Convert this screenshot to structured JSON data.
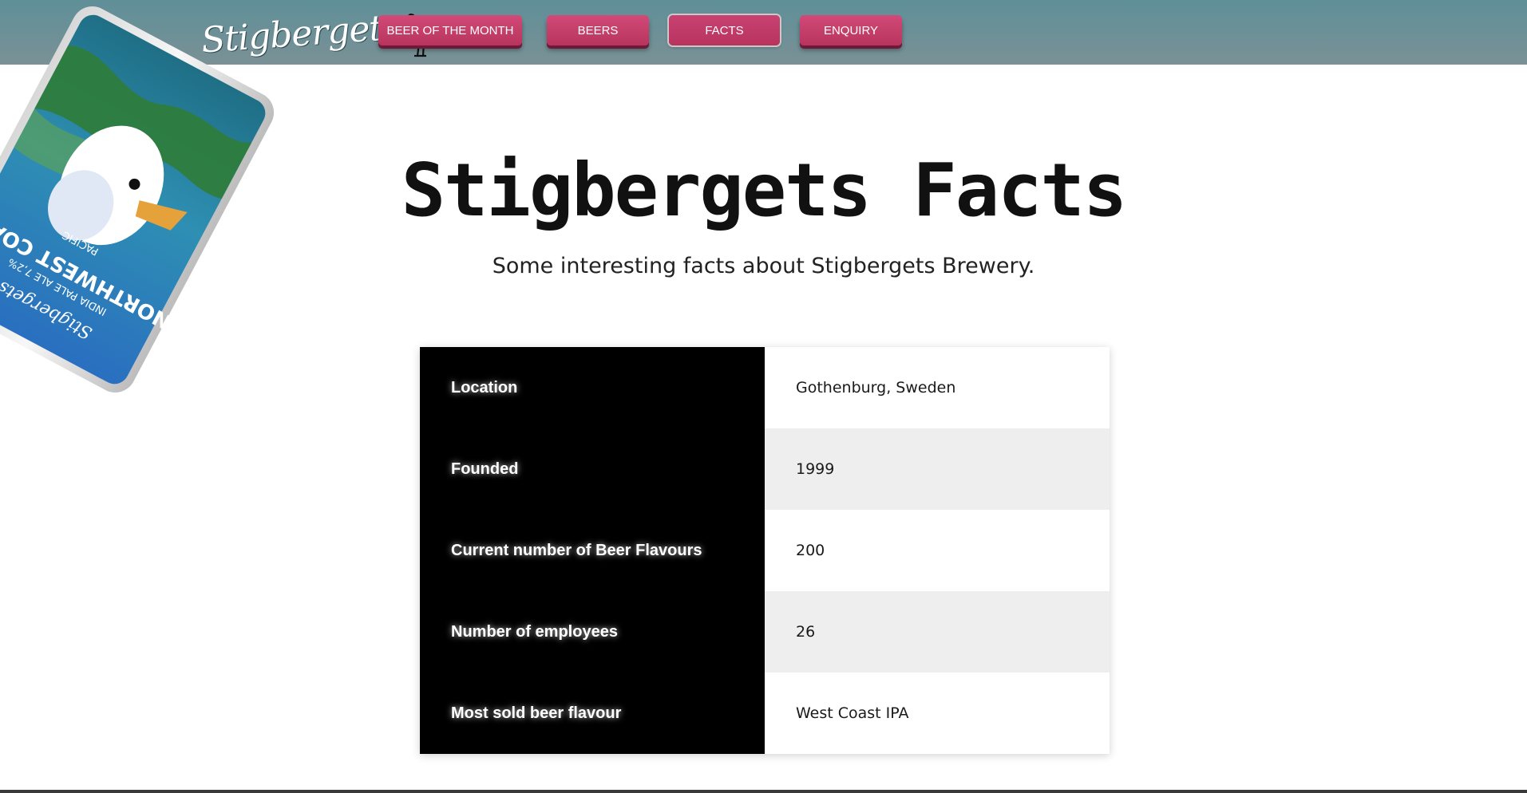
{
  "brand": {
    "logo_text": "Stigbergets"
  },
  "nav": {
    "items": [
      {
        "label": "BEER OF THE MONTH"
      },
      {
        "label": "BEERS"
      },
      {
        "label": "FACTS"
      },
      {
        "label": "ENQUIRY"
      }
    ],
    "active": "FACTS"
  },
  "hero_can": {
    "brand": "Stigbergets",
    "region": "PACIFIC",
    "name": "NORTHWEST COAST",
    "style": "INDIA PALE ALE 7,2%"
  },
  "page": {
    "title": "Stigbergets Facts",
    "subtitle": "Some interesting facts about Stigbergets Brewery."
  },
  "facts": [
    {
      "label": "Location",
      "value": "Gothenburg, Sweden"
    },
    {
      "label": "Founded",
      "value": "1999"
    },
    {
      "label": "Current number of Beer Flavours",
      "value": "200"
    },
    {
      "label": "Number of employees",
      "value": "26"
    },
    {
      "label": "Most sold beer flavour",
      "value": "West Coast IPA"
    }
  ],
  "colors": {
    "navbar": "#6a9198",
    "button": "#c43d69",
    "table_key_bg": "#000000",
    "table_alt_row": "#eeeeee"
  }
}
